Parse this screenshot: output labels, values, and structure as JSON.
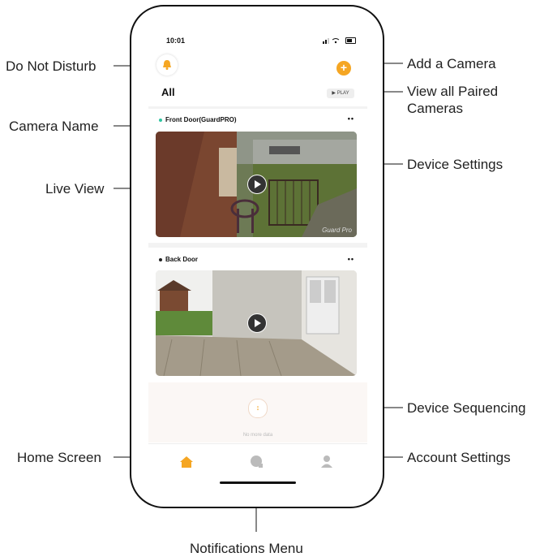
{
  "callouts": {
    "do_not_disturb": "Do Not Disturb",
    "add_camera": "Add a Camera",
    "view_all_line1": "View all Paired",
    "view_all_line2": "Cameras",
    "camera_name": "Camera Name",
    "device_settings": "Device Settings",
    "live_view": "Live View",
    "device_sequencing": "Device Sequencing",
    "home_screen": "Home Screen",
    "account_settings": "Account Settings",
    "notifications_menu": "Notifications Menu"
  },
  "app": {
    "status_time": "10:01",
    "title": "All",
    "play_label": "▶ PLAY",
    "add_symbol": "+",
    "more_symbol": "••",
    "sequencing_symbol": "↕",
    "footer_text": "No more data",
    "cameras": [
      {
        "name": "Front Door(GuardPRO)",
        "status_color": "#2ec4a0",
        "watermark": "Guard Pro"
      },
      {
        "name": "Back Door",
        "status_color": "#222222"
      }
    ]
  },
  "colors": {
    "accent": "#f5a623",
    "line": "#111111"
  },
  "icons": [
    "bell-icon",
    "plus-icon",
    "play-icon",
    "more-icon",
    "home-icon",
    "notifications-icon",
    "account-icon",
    "sequencing-icon"
  ]
}
